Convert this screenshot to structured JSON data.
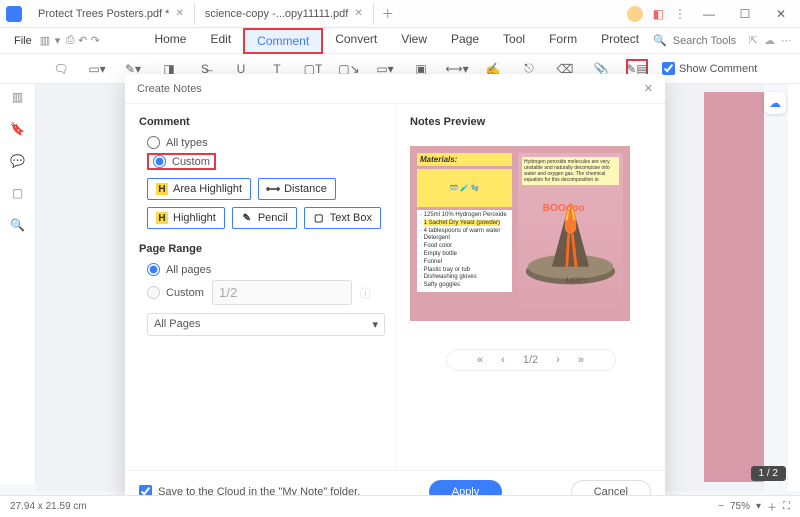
{
  "titlebar": {
    "tabs": [
      {
        "label": "Protect Trees Posters.pdf *"
      },
      {
        "label": "science-copy -...opy11111.pdf"
      }
    ]
  },
  "menubar": {
    "file": "File",
    "tabs": [
      "Home",
      "Edit",
      "Comment",
      "Convert",
      "View",
      "Page",
      "Tool",
      "Form",
      "Protect"
    ],
    "active_index": 2,
    "search_placeholder": "Search Tools"
  },
  "toolbar": {
    "show_comment": "Show Comment"
  },
  "dialog": {
    "title": "Create Notes",
    "section_comment": "Comment",
    "radio_all": "All types",
    "radio_custom": "Custom",
    "chips": [
      "Area Highlight",
      "Distance",
      "Highlight",
      "Pencil",
      "Text Box"
    ],
    "section_page": "Page Range",
    "radio_allpages": "All pages",
    "radio_custom_pages": "Custom",
    "custom_pages_value": "1/2",
    "dropdown_value": "All Pages",
    "preview_title": "Notes Preview",
    "materials_header": "Materials:",
    "materials_list": [
      "125ml 10% Hydrogen Peroxide",
      "1 Sachet Dry Yeast (powder)",
      "4 tablespoons of warm water",
      "Detergent",
      "Food color",
      "Empty bottle",
      "Funnel",
      "Plastic tray or tub",
      "Dishwashing gloves",
      "Safty goggles"
    ],
    "sticky_note": "Hydrogen peroxide molecules are very unstable and naturally decompose into water and oxygen gas. The chemical equation for this decomposition is:",
    "temp_label": "4400°c",
    "boom_label": "BOOooo",
    "pager_value": "1/2",
    "save_cloud": "Save to the Cloud in the \"My Note\" folder.",
    "btn_apply": "Apply",
    "btn_cancel": "Cancel"
  },
  "status": {
    "dims": "27.94 x 21.59 cm",
    "zoom": "75%",
    "page": "1 / 2"
  }
}
